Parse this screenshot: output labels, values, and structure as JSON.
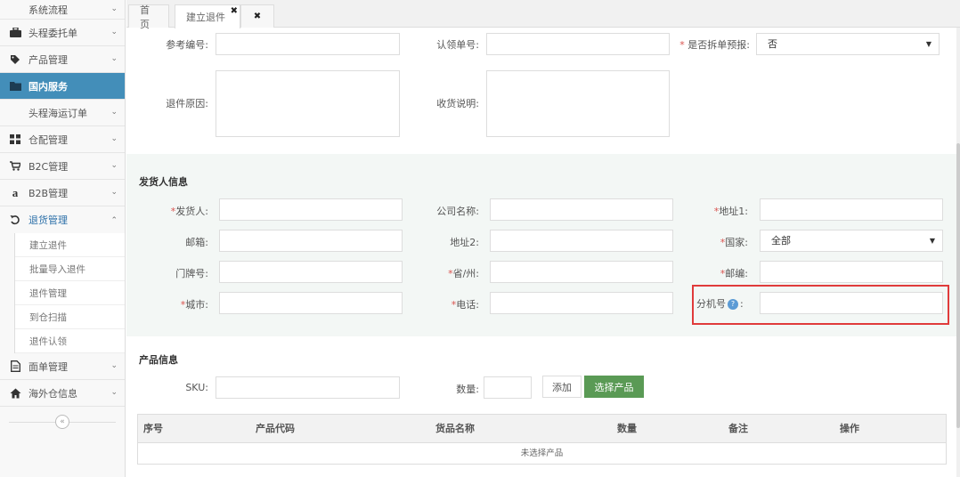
{
  "sidebar": {
    "items": [
      {
        "label": "系统流程",
        "icon": "none"
      },
      {
        "label": "头程委托单",
        "icon": "briefcase-icon"
      },
      {
        "label": "产品管理",
        "icon": "tag-icon"
      },
      {
        "label": "国内服务",
        "icon": "folder-icon"
      },
      {
        "label": "头程海运订单",
        "icon": "none"
      },
      {
        "label": "仓配管理",
        "icon": "grid-icon"
      },
      {
        "label": "B2C管理",
        "icon": "cart-icon"
      },
      {
        "label": "B2B管理",
        "icon": "amazon-icon"
      },
      {
        "label": "退货管理",
        "icon": "undo-icon"
      }
    ],
    "submenu": [
      "建立退件",
      "批量导入退件",
      "退件管理",
      "到仓扫描",
      "退件认领"
    ],
    "items_after": [
      {
        "label": "面单管理",
        "icon": "document-icon"
      },
      {
        "label": "海外仓信息",
        "icon": "home-icon"
      }
    ],
    "collapse_glyph": "«"
  },
  "tabs": {
    "home": "首页",
    "active": "建立退件",
    "active_close": "✖",
    "close_all": "✖"
  },
  "form_top": {
    "ref_no_label": "参考编号:",
    "claim_no_label": "认领单号:",
    "split_label": "是否拆单预报:",
    "split_required": "*",
    "split_value": "否",
    "reason_label": "退件原因:",
    "receipt_label": "收货说明:"
  },
  "shipper": {
    "title": "发货人信息",
    "sender_label": "发货人:",
    "company_label": "公司名称:",
    "address1_label": "地址1:",
    "email_label": "邮箱:",
    "address2_label": "地址2:",
    "country_label": "国家:",
    "country_value": "全部",
    "house_label": "门牌号:",
    "province_label": "省/州:",
    "zip_label": "邮编:",
    "city_label": "城市:",
    "phone_label": "电话:",
    "ext_label": "分机号",
    "ext_colon": ":",
    "required": "*"
  },
  "product": {
    "title": "产品信息",
    "sku_label": "SKU:",
    "qty_label": "数量:",
    "add_button": "添加",
    "select_button": "选择产品",
    "columns": [
      "序号",
      "产品代码",
      "货品名称",
      "数量",
      "备注",
      "操作"
    ],
    "empty_text": "未选择产品"
  },
  "colors": {
    "active_menu": "#438eb9",
    "select_button": "#5a9a55",
    "highlight": "#e03b3b",
    "required": "#d9534f"
  }
}
